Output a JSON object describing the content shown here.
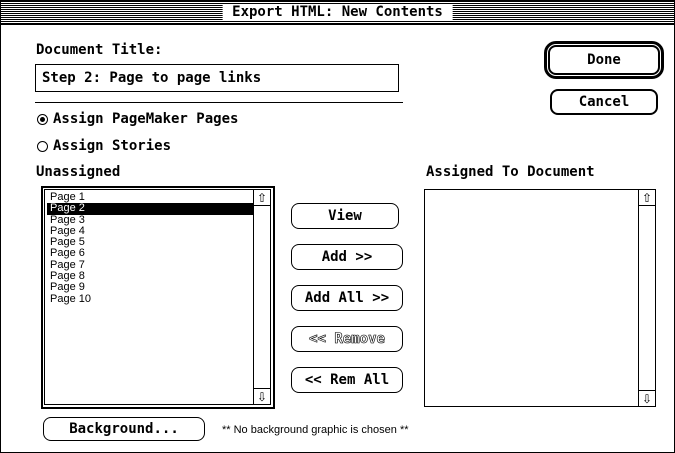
{
  "window": {
    "title": "Export HTML: New Contents"
  },
  "document_title": {
    "label": "Document Title:",
    "value": "Step 2: Page to page links"
  },
  "buttons": {
    "done": "Done",
    "cancel": "Cancel",
    "view": "View",
    "add": "Add >>",
    "add_all": "Add All >>",
    "remove": "<< Remove",
    "rem_all": "<< Rem All",
    "background": "Background..."
  },
  "radios": {
    "assign_pages": {
      "label": "Assign PageMaker Pages",
      "selected": true
    },
    "assign_stories": {
      "label": "Assign Stories",
      "selected": false
    }
  },
  "unassigned": {
    "label": "Unassigned",
    "items": [
      "Page 1",
      "Page 2",
      "Page 3",
      "Page 4",
      "Page 5",
      "Page 6",
      "Page 7",
      "Page 8",
      "Page 9",
      "Page 10"
    ],
    "selected_index": 1
  },
  "assigned": {
    "label": "Assigned To Document",
    "items": []
  },
  "background_note": "** No background graphic is chosen **",
  "icons": {
    "scroll_up": "up-arrow-icon",
    "scroll_down": "down-arrow-icon"
  }
}
